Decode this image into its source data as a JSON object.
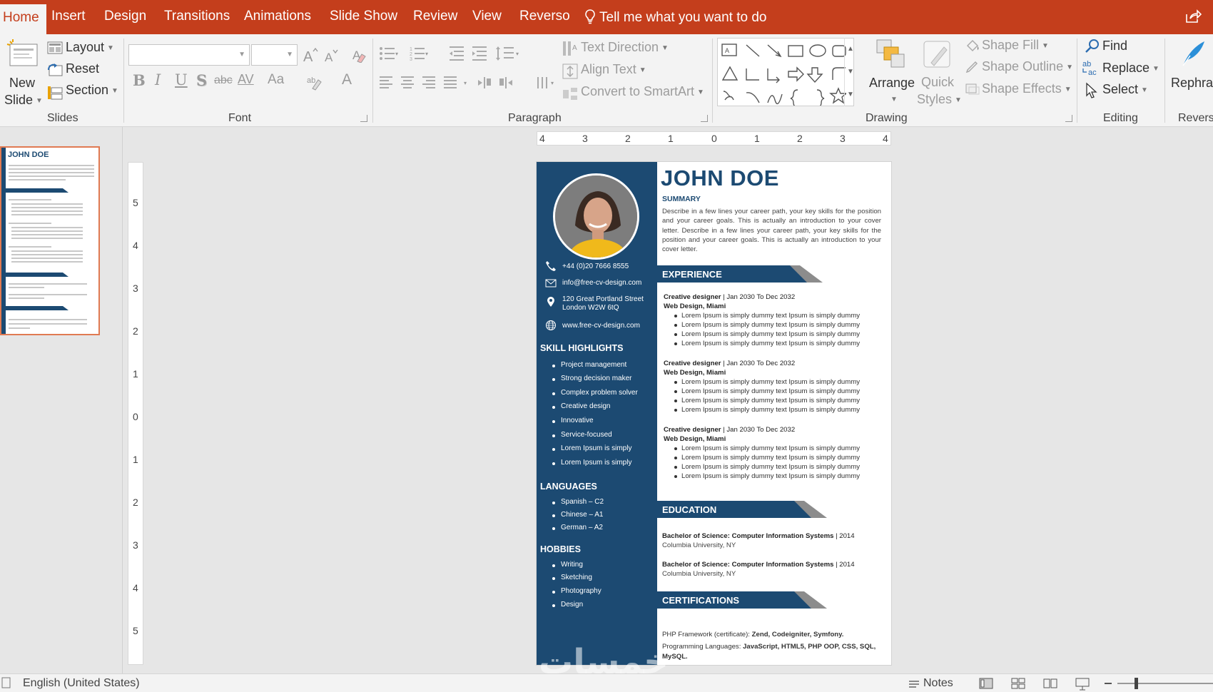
{
  "ribbon_tabs": [
    "Home",
    "Insert",
    "Design",
    "Transitions",
    "Animations",
    "Slide Show",
    "Review",
    "View",
    "Reverso"
  ],
  "tell_me": "Tell me what you want to do",
  "slides_group": {
    "new_slide_line1": "New",
    "new_slide_line2": "Slide",
    "layout": "Layout",
    "reset": "Reset",
    "section": "Section",
    "label": "Slides"
  },
  "font_group": {
    "label": "Font",
    "underline": "U",
    "bold": "B",
    "italic": "I",
    "shadow": "S",
    "strike": "abc",
    "spacing": "AV",
    "change_case": "Aa",
    "color_a": "A"
  },
  "paragraph_group": {
    "label": "Paragraph",
    "text_direction": "Text Direction",
    "align_text": "Align Text",
    "convert_smartart": "Convert to SmartArt"
  },
  "drawing_group": {
    "label": "Drawing",
    "arrange": "Arrange",
    "quick_styles_1": "Quick",
    "quick_styles_2": "Styles",
    "shape_fill": "Shape Fill",
    "shape_outline": "Shape Outline",
    "shape_effects": "Shape Effects"
  },
  "editing_group": {
    "label": "Editing",
    "find": "Find",
    "replace": "Replace",
    "select": "Select"
  },
  "reverso_group": {
    "rephrase": "Rephras",
    "label": "Revers"
  },
  "rulers": {
    "horizontal": [
      "4",
      "3",
      "2",
      "1",
      "0",
      "1",
      "2",
      "3",
      "4"
    ],
    "vertical": [
      "5",
      "4",
      "3",
      "2",
      "1",
      "0",
      "1",
      "2",
      "3",
      "4",
      "5"
    ]
  },
  "resume": {
    "name": "JOHN DOE",
    "summary_heading": "SUMMARY",
    "summary_text": "Describe in a few lines your career path, your key skills for the position and your career goals. This is actually an introduction to your cover letter. Describe in a few lines your career path, your key skills for the position and your career goals. This is actually an introduction to your cover letter.",
    "contact": {
      "phone": "+44 (0)20 7666 8555",
      "email": "info@free-cv-design.com",
      "address_1": "120 Great Portland Street",
      "address_2": "London W2W 6tQ",
      "website": "www.free-cv-design.com"
    },
    "skills_heading": "SKILL HIGHLIGHTS",
    "skills": [
      "Project management",
      "Strong decision maker",
      "Complex problem solver",
      "Creative design",
      "Innovative",
      "Service-focused",
      "Lorem Ipsum is simply",
      "Lorem Ipsum is simply"
    ],
    "languages_heading": "LANGUAGES",
    "languages": [
      "Spanish – C2",
      "Chinese – A1",
      "German – A2"
    ],
    "hobbies_heading": "HOBBIES",
    "hobbies": [
      "Writing",
      "Sketching",
      "Photography",
      "Design"
    ],
    "experience_heading": "EXPERIENCE",
    "experience": [
      {
        "title": "Creative designer",
        "dates": " | Jan 2030 To Dec 2032",
        "company": "Web Design, Miami",
        "bullets": [
          "Lorem Ipsum is simply dummy text Ipsum is simply dummy",
          "Lorem Ipsum is simply dummy text Ipsum is simply dummy",
          "Lorem Ipsum is simply dummy text Ipsum is simply dummy",
          "Lorem Ipsum is simply dummy text Ipsum is simply dummy"
        ]
      },
      {
        "title": "Creative designer",
        "dates": " | Jan 2030 To Dec 2032",
        "company": "Web Design, Miami",
        "bullets": [
          "Lorem Ipsum is simply dummy text Ipsum is simply dummy",
          "Lorem Ipsum is simply dummy text Ipsum is simply dummy",
          "Lorem Ipsum is simply dummy text Ipsum is simply dummy",
          "Lorem Ipsum is simply dummy text Ipsum is simply dummy"
        ]
      },
      {
        "title": "Creative designer",
        "dates": " | Jan 2030 To Dec 2032",
        "company": "Web Design, Miami",
        "bullets": [
          "Lorem Ipsum is simply dummy text Ipsum is simply dummy",
          "Lorem Ipsum is simply dummy text Ipsum is simply dummy",
          "Lorem Ipsum is simply dummy text Ipsum is simply dummy",
          "Lorem Ipsum is simply dummy text Ipsum is simply dummy"
        ]
      }
    ],
    "education_heading": "EDUCATION",
    "education": [
      {
        "degree": "Bachelor of Science: Computer Information Systems",
        "year": " | 2014",
        "school": "Columbia University, NY"
      },
      {
        "degree": "Bachelor of Science: Computer Information Systems",
        "year": " | 2014",
        "school": "Columbia University, NY"
      }
    ],
    "certifications_heading": "CERTIFICATIONS",
    "cert_line_1_prefix": "PHP Framework (certificate): ",
    "cert_line_1_bold": "Zend, Codeigniter, Symfony.",
    "cert_line_2_prefix": "Programming Languages: ",
    "cert_line_2_bold": "JavaScript, HTML5, PHP OOP, CSS, SQL, MySQL."
  },
  "thumbnail": {
    "name": "JOHN DOE"
  },
  "watermark": "خمسات",
  "status_bar": {
    "language": "English (United States)",
    "notes": "Notes"
  },
  "colors": {
    "ribbon_accent": "#c43e1c",
    "resume_navy": "#1c4a72",
    "band_shadow": "#8c8c8c",
    "thumb_border": "#e07a52"
  }
}
